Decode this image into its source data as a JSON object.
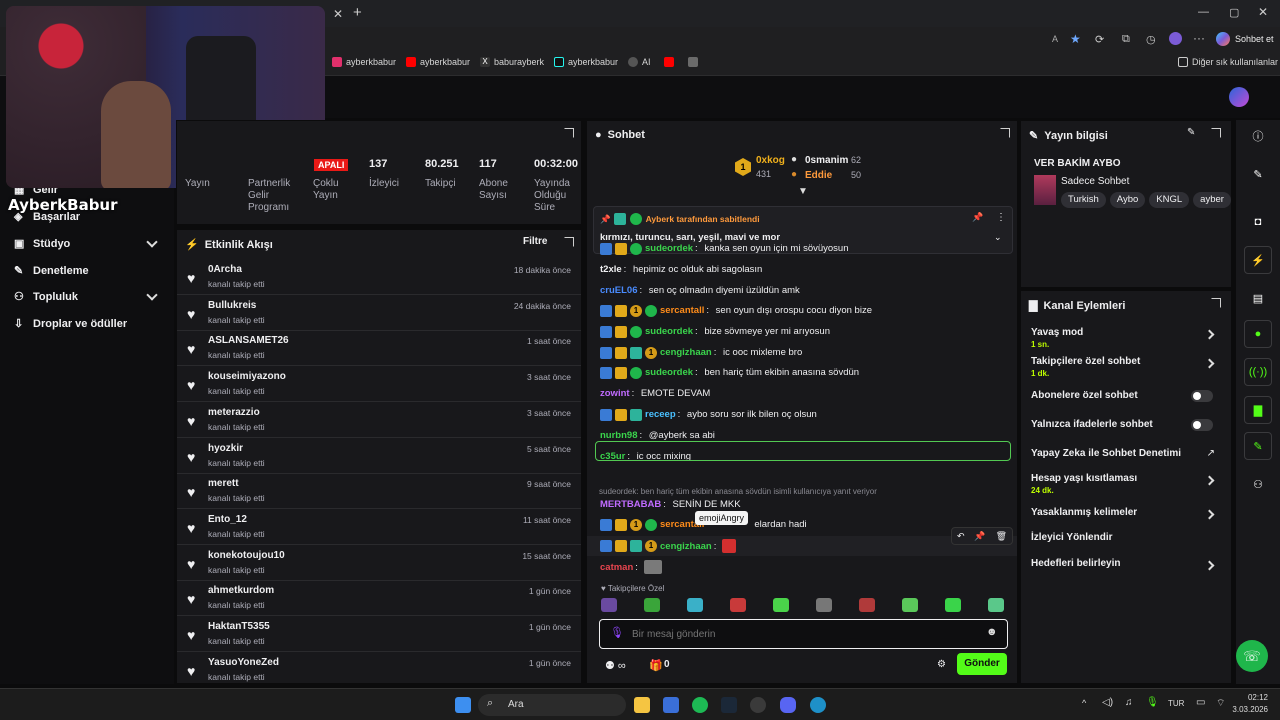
{
  "browser": {
    "title": "Sohbet et",
    "bookmarks": [
      "ayberkbabur",
      "ayberkbabur",
      "baburayberk",
      "ayberkbabur",
      "AI"
    ],
    "other_bookmarks": "Diğer sık kullanılanlar"
  },
  "webcam": {
    "watermark": "AyberkBabur"
  },
  "nav": {
    "items": [
      {
        "label": "Gelir"
      },
      {
        "label": "Başarılar"
      },
      {
        "label": "Stüdyo"
      },
      {
        "label": "Denetleme"
      },
      {
        "label": "Topluluk"
      },
      {
        "label": "Droplar ve ödüller"
      }
    ]
  },
  "stats": {
    "status_badge": "APALI",
    "cols": [
      {
        "value": "",
        "label": "Yayın"
      },
      {
        "value": "",
        "label": "Partnerlik Gelir Programı"
      },
      {
        "value": "",
        "label": "Çoklu Yayın"
      },
      {
        "value": "137",
        "label": "İzleyici"
      },
      {
        "value": "80.251",
        "label": "Takipçi"
      },
      {
        "value": "117",
        "label": "Abone Sayısı"
      },
      {
        "value": "00:32:00",
        "label": "Yayında Olduğu Süre"
      }
    ]
  },
  "activity": {
    "title": "Etkinlik Akışı",
    "filter": "Filtre",
    "items": [
      {
        "name": "0Archa",
        "sub": "kanalı takip etti",
        "time": "18 dakika önce"
      },
      {
        "name": "Bullukreis",
        "sub": "kanalı takip etti",
        "time": "24 dakika önce"
      },
      {
        "name": "ASLANSAMET26",
        "sub": "kanalı takip etti",
        "time": "1 saat önce"
      },
      {
        "name": "kouseimiyazono",
        "sub": "kanalı takip etti",
        "time": "3 saat önce"
      },
      {
        "name": "meterazzio",
        "sub": "kanalı takip etti",
        "time": "3 saat önce"
      },
      {
        "name": "hyozkir",
        "sub": "kanalı takip etti",
        "time": "5 saat önce"
      },
      {
        "name": "merett",
        "sub": "kanalı takip etti",
        "time": "9 saat önce"
      },
      {
        "name": "Ento_12",
        "sub": "kanalı takip etti",
        "time": "11 saat önce"
      },
      {
        "name": "konekotoujou10",
        "sub": "kanalı takip etti",
        "time": "15 saat önce"
      },
      {
        "name": "ahmetkurdom",
        "sub": "kanalı takip etti",
        "time": "1 gün önce"
      },
      {
        "name": "HaktanT5355",
        "sub": "kanalı takip etti",
        "time": "1 gün önce"
      },
      {
        "name": "YasuoYoneZed",
        "sub": "kanalı takip etti",
        "time": "1 gün önce"
      }
    ]
  },
  "chat": {
    "title": "Sohbet",
    "leaders": [
      {
        "name": "0xkog",
        "score": "431"
      },
      {
        "name": "0smanim",
        "score": "62"
      },
      {
        "name": "Eddie",
        "score": "50"
      }
    ],
    "rank": "1",
    "pinned": {
      "by": "Ayberk tarafından sabitlendi",
      "text": "kırmızı, turuncu, sarı, yeşil, mavi ve mor"
    },
    "messages": [
      {
        "user": "sudeordek",
        "color": "#3ad44c",
        "text": "kanka sen oyun için mi sövüyosun",
        "badges": [
          "blue",
          "gold",
          "green"
        ]
      },
      {
        "user": "t2xle",
        "color": "#efeff1",
        "text": "hepimiz oc olduk abi sagolasın",
        "badges": []
      },
      {
        "user": "cruEL06",
        "color": "#4a8cff",
        "text": "sen oç olmadın diyemi üzüldün amk",
        "badges": []
      },
      {
        "user": "sercantall",
        "color": "#ff8c1a",
        "text": "sen oyun dışı orospu cocu diyon bize",
        "badges": [
          "blue",
          "gold",
          "one",
          "green"
        ]
      },
      {
        "user": "sudeordek",
        "color": "#3ad44c",
        "text": "bize sövmeye yer mi arıyosun",
        "badges": [
          "blue",
          "gold",
          "green"
        ]
      },
      {
        "user": "cengizhaan",
        "color": "#3ad44c",
        "text": "ic ooc mixleme bro",
        "badges": [
          "blue",
          "gold",
          "teal",
          "one"
        ]
      },
      {
        "user": "sudeordek",
        "color": "#3ad44c",
        "text": "ben hariç tüm ekibin anasına sövdün",
        "badges": [
          "blue",
          "gold",
          "green"
        ]
      },
      {
        "user": "zowint",
        "color": "#c06bff",
        "text": "EMOTE DEVAM",
        "badges": []
      },
      {
        "user": "receep",
        "color": "#4ac0ff",
        "text": "aybo soru sor ilk bilen oç olsun",
        "badges": [
          "blue",
          "gold",
          "teal"
        ]
      },
      {
        "user": "nurbn98",
        "color": "#3ad44c",
        "text": "@ayberk sa abi",
        "badges": []
      },
      {
        "user": "c35ur",
        "color": "#3ad44c",
        "text": "ic occ mixing",
        "badges": []
      }
    ],
    "reply_note": "sudeordek: ben hariç tüm ekibin anasına sövdün isimli kullanıcıya yanıt veriyor",
    "reply_msg": {
      "user": "MERTBABAB",
      "text": "SENİN DE MKK"
    },
    "sercan_msg": {
      "user": "sercantall",
      "text": "elardan hadi"
    },
    "cengiz_msg": {
      "user": "cengizhaan",
      "text": ""
    },
    "tooltip": "emojiAngry",
    "catman": "catman",
    "follower_emotes_label": "Takipçilere Özel",
    "input_placeholder": "Bir mesaj gönderin",
    "points": "0",
    "send": "Gönder"
  },
  "info": {
    "title": "Yayın bilgisi",
    "stream_title": "VER BAKİM AYBO",
    "category": "Sadece Sohbet",
    "tags": [
      "Turkish",
      "Aybo",
      "KNGL",
      "ayber"
    ]
  },
  "actions": {
    "title": "Kanal Eylemleri",
    "items": [
      {
        "label": "Yavaş mod",
        "sub": "1 sn.",
        "kind": "arrow"
      },
      {
        "label": "Takipçilere özel sohbet",
        "sub": "1 dk.",
        "kind": "arrow"
      },
      {
        "label": "Abonelere özel sohbet",
        "sub": "",
        "kind": "toggle"
      },
      {
        "label": "Yalnızca ifadelerle sohbet",
        "sub": "",
        "kind": "toggle"
      },
      {
        "label": "Yapay Zeka ile Sohbet Denetimi",
        "sub": "",
        "kind": "ext"
      },
      {
        "label": "Hesap yaşı kısıtlaması",
        "sub": "24 dk.",
        "kind": "arrow"
      },
      {
        "label": "Yasaklanmış kelimeler",
        "sub": "",
        "kind": "arrow"
      },
      {
        "label": "İzleyici Yönlendir",
        "sub": "",
        "kind": "none"
      },
      {
        "label": "Hedefleri belirleyin",
        "sub": "",
        "kind": "arrow"
      }
    ]
  },
  "taskbar": {
    "search": "Ara",
    "lang": "TUR",
    "time": "02:12",
    "date": "3.03.2026"
  }
}
